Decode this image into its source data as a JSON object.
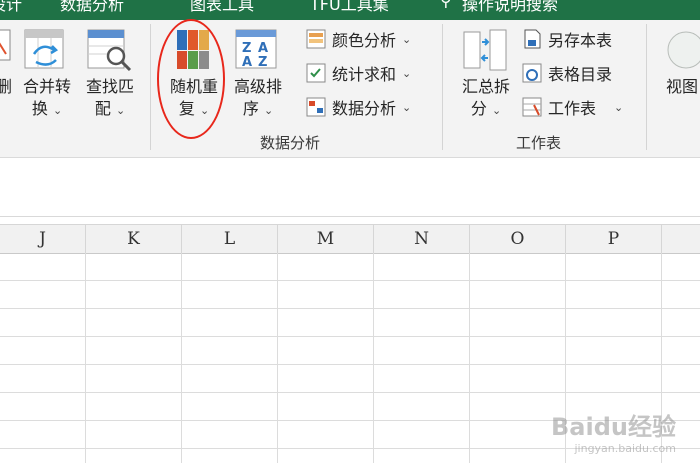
{
  "topbar": {
    "tabs": [
      "设计",
      "数据分析",
      "图表工具",
      "TFU工具集",
      "操作说明搜索"
    ]
  },
  "ribbon": {
    "buttons": {
      "delete_partial": "删",
      "merge": [
        "合并转",
        "换"
      ],
      "lookup": [
        "查找匹",
        "配"
      ],
      "random_repeat": [
        "随机重",
        "复"
      ],
      "advanced_sort": [
        "高级排",
        "序"
      ],
      "summary_split": [
        "汇总拆",
        "分"
      ],
      "view_partial": [
        "视图"
      ]
    },
    "small_items": {
      "color_analysis": "颜色分析",
      "stat_sum": "统计求和",
      "data_analysis": "数据分析",
      "save_as_table": "另存本表",
      "table_directory": "表格目录",
      "worksheet": "工作表"
    },
    "groups": {
      "data_analysis": "数据分析",
      "worksheet": "工作表"
    },
    "caret": "⌄"
  },
  "sheet": {
    "columns": [
      "J",
      "K",
      "L",
      "M",
      "N",
      "O",
      "P"
    ]
  },
  "watermark": {
    "brand": "Baidu经验",
    "url": "jingyan.baidu.com"
  }
}
